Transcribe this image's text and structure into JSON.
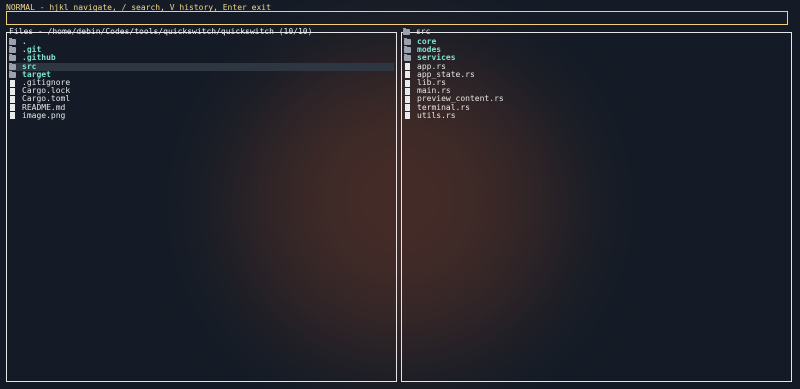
{
  "status_bar": {
    "text": "NORMAL - hjkl navigate, / search, V history, Enter exit"
  },
  "search_input": {
    "value": ""
  },
  "left_panel": {
    "title": "Files - /home/debin/Codes/tools/quickswitch/quickswitch (10/10)",
    "items": [
      {
        "label": ".",
        "kind": "dir",
        "icon": "folder-icon"
      },
      {
        "label": ".git",
        "kind": "dir",
        "icon": "folder-icon"
      },
      {
        "label": ".github",
        "kind": "dir",
        "icon": "folder-icon"
      },
      {
        "label": "src",
        "kind": "dir",
        "icon": "folder-icon",
        "selected": true
      },
      {
        "label": "target",
        "kind": "dir",
        "icon": "folder-icon"
      },
      {
        "label": ".gitignore",
        "kind": "file",
        "icon": "file-icon"
      },
      {
        "label": "Cargo.lock",
        "kind": "file",
        "icon": "file-icon"
      },
      {
        "label": "Cargo.toml",
        "kind": "file",
        "icon": "file-icon"
      },
      {
        "label": "README.md",
        "kind": "file",
        "icon": "file-icon"
      },
      {
        "label": "image.png",
        "kind": "file",
        "icon": "file-icon"
      }
    ]
  },
  "right_panel": {
    "title": "src",
    "title_icon": "folder-icon",
    "items": [
      {
        "label": "core",
        "kind": "dir",
        "icon": "folder-icon"
      },
      {
        "label": "modes",
        "kind": "dir",
        "icon": "folder-icon"
      },
      {
        "label": "services",
        "kind": "dir",
        "icon": "folder-icon"
      },
      {
        "label": "app.rs",
        "kind": "file",
        "icon": "file-icon"
      },
      {
        "label": "app_state.rs",
        "kind": "file",
        "icon": "file-icon"
      },
      {
        "label": "lib.rs",
        "kind": "file",
        "icon": "file-icon"
      },
      {
        "label": "main.rs",
        "kind": "file",
        "icon": "file-icon"
      },
      {
        "label": "preview_content.rs",
        "kind": "file",
        "icon": "file-icon"
      },
      {
        "label": "terminal.rs",
        "kind": "file",
        "icon": "file-icon"
      },
      {
        "label": "utils.rs",
        "kind": "file",
        "icon": "file-icon"
      }
    ]
  },
  "colors": {
    "background": "#161d27",
    "status_text": "#f2d58a",
    "input_border": "#f0d07a",
    "directory_text": "#7fe3d3",
    "file_text": "#e6e6e6",
    "selected_row": "#2e3641"
  }
}
